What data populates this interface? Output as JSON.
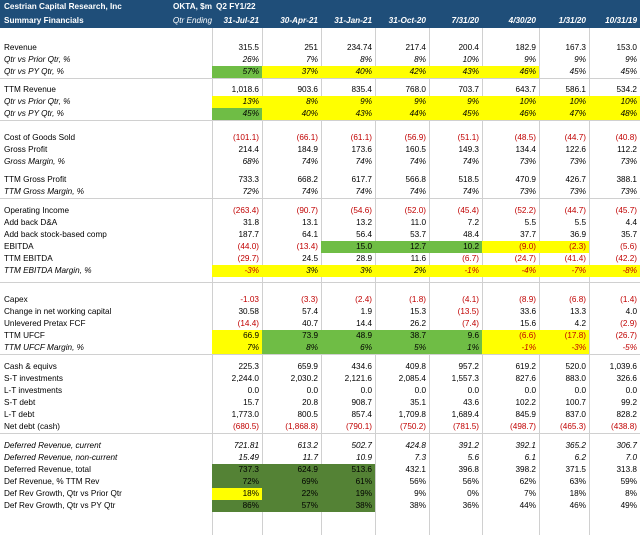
{
  "header": {
    "company": "Cestrian Capital Research, Inc",
    "subtitle": "Summary Financials",
    "ticker": "OKTA, $m",
    "qtr_ending": "Qtr Ending",
    "fiscal_label": "Q2 FY1/22",
    "dates": [
      "31-Jul-21",
      "30-Apr-21",
      "31-Jan-21",
      "31-Oct-20",
      "7/31/20",
      "4/30/20",
      "1/31/20",
      "10/31/19"
    ]
  },
  "colors": {
    "header_bg": "#1f4e79",
    "highlight_yellow": "#ffff00",
    "highlight_green": "#6fbd45",
    "highlight_dark_green": "#548235",
    "negative_red": "#c00000"
  },
  "rows": [
    {
      "label": "Revenue",
      "values": [
        "315.5",
        "251",
        "234.74",
        "217.4",
        "200.4",
        "182.9",
        "167.3",
        "153.0"
      ]
    },
    {
      "label": "Qtr vs Prior Qtr, %",
      "italic": true,
      "values": [
        "26%",
        "7%",
        "8%",
        "8%",
        "10%",
        "9%",
        "9%",
        "9%"
      ]
    },
    {
      "label": "Qtr vs PY Qtr, %",
      "italic": true,
      "values": [
        "57%",
        "37%",
        "40%",
        "42%",
        "43%",
        "46%",
        "45%",
        "45%"
      ]
    },
    {
      "label": "TTM Revenue",
      "values": [
        "1,018.6",
        "903.6",
        "835.4",
        "768.0",
        "703.7",
        "643.7",
        "586.1",
        "534.2"
      ]
    },
    {
      "label": "Qtr vs Prior Qtr, %",
      "italic": true,
      "values": [
        "13%",
        "8%",
        "9%",
        "9%",
        "9%",
        "10%",
        "10%",
        "10%"
      ]
    },
    {
      "label": "Qtr vs PY Qtr, %",
      "italic": true,
      "values": [
        "45%",
        "40%",
        "43%",
        "44%",
        "45%",
        "46%",
        "47%",
        "48%"
      ]
    },
    {
      "label": "Cost of Goods Sold",
      "values": [
        "(101.1)",
        "(66.1)",
        "(61.1)",
        "(56.9)",
        "(51.1)",
        "(48.5)",
        "(44.7)",
        "(40.8)"
      ]
    },
    {
      "label": "Gross Profit",
      "values": [
        "214.4",
        "184.9",
        "173.6",
        "160.5",
        "149.3",
        "134.4",
        "122.6",
        "112.2"
      ]
    },
    {
      "label": "Gross Margin, %",
      "italic": true,
      "values": [
        "68%",
        "74%",
        "74%",
        "74%",
        "74%",
        "73%",
        "73%",
        "73%"
      ]
    },
    {
      "label": "TTM Gross Profit",
      "values": [
        "733.3",
        "668.2",
        "617.7",
        "566.8",
        "518.5",
        "470.9",
        "426.7",
        "388.1"
      ]
    },
    {
      "label": "TTM Gross Margin, %",
      "italic": true,
      "values": [
        "72%",
        "74%",
        "74%",
        "74%",
        "74%",
        "73%",
        "73%",
        "73%"
      ]
    },
    {
      "label": "Operating Income",
      "values": [
        "(263.4)",
        "(90.7)",
        "(54.6)",
        "(52.0)",
        "(45.4)",
        "(52.2)",
        "(44.7)",
        "(45.7)"
      ]
    },
    {
      "label": "Add back D&A",
      "values": [
        "31.8",
        "13.1",
        "13.2",
        "11.0",
        "7.2",
        "5.5",
        "5.5",
        "4.4"
      ]
    },
    {
      "label": "Add back stock-based comp",
      "values": [
        "187.7",
        "64.1",
        "56.4",
        "53.7",
        "48.4",
        "37.7",
        "36.9",
        "35.7"
      ]
    },
    {
      "label": "EBITDA",
      "values": [
        "(44.0)",
        "(13.4)",
        "15.0",
        "12.7",
        "10.2",
        "(9.0)",
        "(2.3)",
        "(5.6)"
      ]
    },
    {
      "label": "TTM EBITDA",
      "values": [
        "(29.7)",
        "24.5",
        "28.9",
        "11.6",
        "(6.7)",
        "(24.7)",
        "(41.4)",
        "(42.2)"
      ]
    },
    {
      "label": "TTM EBITDA Margin, %",
      "italic": true,
      "values": [
        "-3%",
        "3%",
        "3%",
        "2%",
        "-1%",
        "-4%",
        "-7%",
        "-8%"
      ]
    },
    {
      "label": "Capex",
      "values": [
        "-1.03",
        "(3.3)",
        "(2.4)",
        "(1.8)",
        "(4.1)",
        "(8.9)",
        "(6.8)",
        "(1.4)"
      ]
    },
    {
      "label": "Change in net working capital",
      "values": [
        "30.58",
        "57.4",
        "1.9",
        "15.3",
        "(13.5)",
        "33.6",
        "13.3",
        "4.0"
      ]
    },
    {
      "label": "Unlevered Pretax FCF",
      "values": [
        "(14.4)",
        "40.7",
        "14.4",
        "26.2",
        "(7.4)",
        "15.6",
        "4.2",
        "(2.9)"
      ]
    },
    {
      "label": "TTM UFCF",
      "values": [
        "66.9",
        "73.9",
        "48.9",
        "38.7",
        "9.6",
        "(6.6)",
        "(17.8)",
        "(26.7)"
      ]
    },
    {
      "label": "TTM UFCF Margin, %",
      "italic": true,
      "values": [
        "7%",
        "8%",
        "6%",
        "5%",
        "1%",
        "-1%",
        "-3%",
        "-5%"
      ]
    },
    {
      "label": "Cash & equivs",
      "values": [
        "225.3",
        "659.9",
        "434.6",
        "409.8",
        "957.2",
        "619.2",
        "520.0",
        "1,039.6"
      ]
    },
    {
      "label": "S-T investments",
      "values": [
        "2,244.0",
        "2,030.2",
        "2,121.6",
        "2,085.4",
        "1,557.3",
        "827.6",
        "883.0",
        "326.6"
      ]
    },
    {
      "label": "L-T investments",
      "values": [
        "0.0",
        "0.0",
        "0.0",
        "0.0",
        "0.0",
        "0.0",
        "0.0",
        "0.0"
      ]
    },
    {
      "label": "S-T debt",
      "values": [
        "15.7",
        "20.8",
        "908.7",
        "35.1",
        "43.6",
        "102.2",
        "100.7",
        "99.2"
      ]
    },
    {
      "label": "L-T debt",
      "values": [
        "1,773.0",
        "800.5",
        "857.4",
        "1,709.8",
        "1,689.4",
        "845.9",
        "837.0",
        "828.2"
      ]
    },
    {
      "label": "Net debt (cash)",
      "values": [
        "(680.5)",
        "(1,868.8)",
        "(790.1)",
        "(750.2)",
        "(781.5)",
        "(498.7)",
        "(465.3)",
        "(438.8)"
      ]
    },
    {
      "label": "Deferred Revenue, current",
      "italic": true,
      "values": [
        "721.81",
        "613.2",
        "502.7",
        "424.8",
        "391.2",
        "392.1",
        "365.2",
        "306.7"
      ]
    },
    {
      "label": "Deferred Revenue, non-current",
      "italic": true,
      "values": [
        "15.49",
        "11.7",
        "10.9",
        "7.3",
        "5.6",
        "6.1",
        "6.2",
        "7.0"
      ]
    },
    {
      "label": "Deferred Revenue, total",
      "values": [
        "737.3",
        "624.9",
        "513.6",
        "432.1",
        "396.8",
        "398.2",
        "371.5",
        "313.8"
      ]
    },
    {
      "label": "Def Revenue, % TTM Rev",
      "values": [
        "72%",
        "69%",
        "61%",
        "56%",
        "56%",
        "62%",
        "63%",
        "59%"
      ]
    },
    {
      "label": "Def Rev Growth, Qtr vs Prior Qtr",
      "values": [
        "18%",
        "22%",
        "19%",
        "9%",
        "0%",
        "7%",
        "18%",
        "8%"
      ]
    },
    {
      "label": "Def Rev Growth, Qtr vs PY Qtr",
      "values": [
        "86%",
        "57%",
        "38%",
        "38%",
        "36%",
        "44%",
        "46%",
        "49%"
      ]
    }
  ]
}
